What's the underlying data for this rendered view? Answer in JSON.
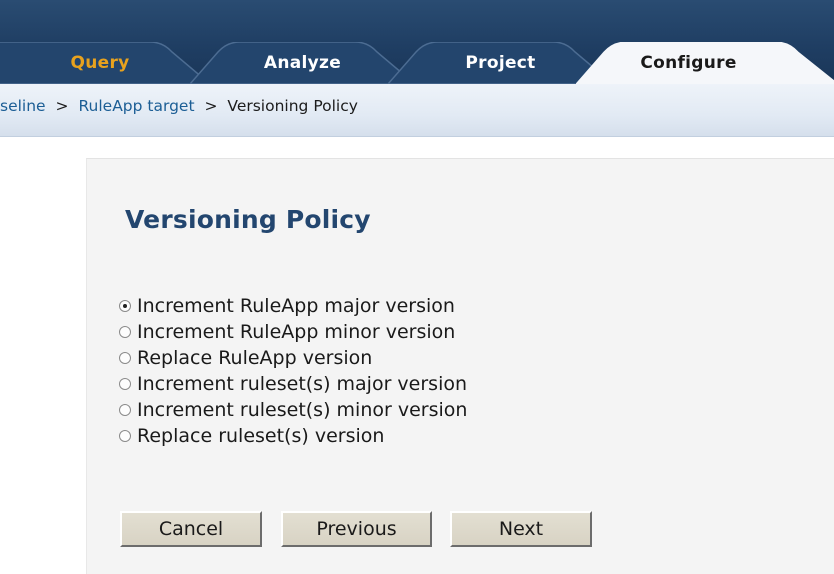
{
  "tabs": [
    {
      "label": "Query",
      "state": "inactive",
      "color": "#e8a21e"
    },
    {
      "label": "Analyze",
      "state": "inactive",
      "color": "#ffffff"
    },
    {
      "label": "Project",
      "state": "inactive",
      "color": "#ffffff"
    },
    {
      "label": "Configure",
      "state": "active",
      "color": "#1a1a1a"
    }
  ],
  "breadcrumb": {
    "items": [
      "seline",
      "RuleApp target",
      "Versioning Policy"
    ],
    "separator": ">"
  },
  "page": {
    "title": "Versioning Policy"
  },
  "versioning_options": [
    {
      "label": "Increment RuleApp major version",
      "checked": true
    },
    {
      "label": "Increment RuleApp minor version",
      "checked": false
    },
    {
      "label": "Replace RuleApp version",
      "checked": false
    },
    {
      "label": "Increment ruleset(s) major version",
      "checked": false
    },
    {
      "label": "Increment ruleset(s) minor version",
      "checked": false
    },
    {
      "label": "Replace ruleset(s) version",
      "checked": false
    }
  ],
  "buttons": {
    "cancel": "Cancel",
    "previous": "Previous",
    "next": "Next"
  },
  "colors": {
    "header_bg": "#1f3e63",
    "tab_inactive": "#23456d",
    "tab_active": "#f5f7fa",
    "title": "#23466f",
    "link": "#1c5e95",
    "panel_bg": "#f4f4f4",
    "button_bg": "#dcd8ca"
  }
}
